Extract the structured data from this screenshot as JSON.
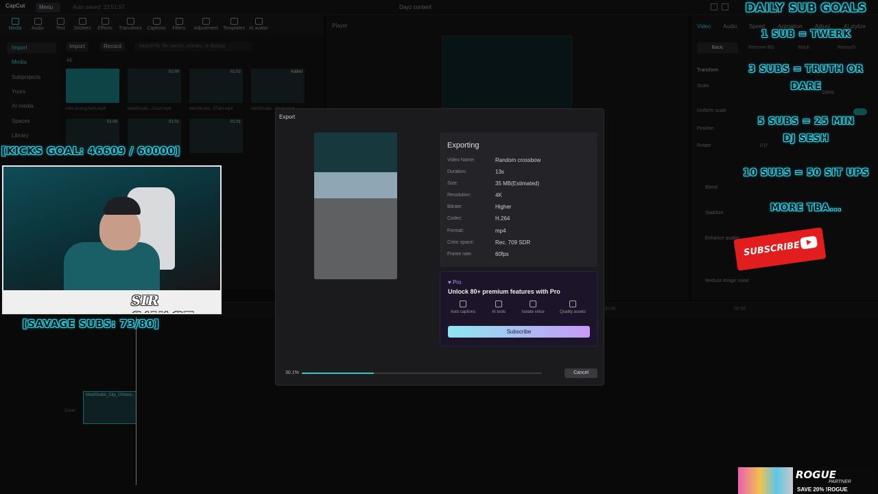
{
  "app": {
    "logo": "CapCut",
    "menu_label": "Menu",
    "autosave": "Auto saved: 23:51:57",
    "project_title": "Dayz content"
  },
  "toolbar": {
    "items": [
      "Media",
      "Audio",
      "Text",
      "Stickers",
      "Effects",
      "Transitions",
      "Captions",
      "Filters",
      "Adjustment",
      "Templates",
      "AI avatar"
    ]
  },
  "left_nav": {
    "items": [
      "Import",
      "Media",
      "Subprojects",
      "Yours",
      "AI media",
      "Spaces",
      "Library"
    ]
  },
  "media": {
    "import_label": "Import",
    "record_label": "Record",
    "search_placeholder": "Search for file names, scenes, or dialogs",
    "filter_all": "All",
    "thumbs": [
      {
        "dur": "",
        "name": "intro to king farm.mp4"
      },
      {
        "dur": "01:00",
        "name": "MeldStudio...21am.mp4"
      },
      {
        "dur": "01:02",
        "name": "MeldStudio...07am.mp4"
      },
      {
        "dur": "Added",
        "name": "MeldStudio...44am.mp4"
      },
      {
        "dur": "01:00",
        "name": ""
      },
      {
        "dur": "01:01",
        "name": ""
      },
      {
        "dur": "01:01",
        "name": ""
      }
    ]
  },
  "player": {
    "title": "Player"
  },
  "inspector": {
    "tabs": [
      "Video",
      "Audio",
      "Speed",
      "Animation",
      "Adjust",
      "AI stylize"
    ],
    "subtabs": [
      "Basic",
      "Remove BG",
      "Mask",
      "Retouch"
    ],
    "props": [
      "Transform",
      "Scale",
      "Uniform scale",
      "Position",
      "Rotate",
      "Blend",
      "Stabilize",
      "Enhance quality",
      "Reduce image noise"
    ],
    "scale_value": "100%",
    "rotate_value": "0.0°"
  },
  "export": {
    "title": "Export",
    "heading": "Exporting",
    "fields": [
      {
        "key": "Video Name:",
        "value": "Random crossbow"
      },
      {
        "key": "Duration:",
        "value": "13s"
      },
      {
        "key": "Size:",
        "value": "35 MB(Estimated)"
      },
      {
        "key": "Resolution:",
        "value": "4K"
      },
      {
        "key": "Bitrate:",
        "value": "Higher"
      },
      {
        "key": "Codec:",
        "value": "H.264"
      },
      {
        "key": "Format:",
        "value": "mp4"
      },
      {
        "key": "Color space:",
        "value": "Rec. 709 SDR"
      },
      {
        "key": "Frame rate:",
        "value": "60fps"
      }
    ],
    "pro_badge": "♥ Pro",
    "pro_unlock": "Unlock 80+ premium features with Pro",
    "pro_features": [
      "Auto captions",
      "AI tools",
      "Isolate voice",
      "Quality assets"
    ],
    "subscribe_label": "Subscribe",
    "progress_label": "30.1%",
    "progress": 0.301,
    "cancel_label": "Cancel"
  },
  "timeline": {
    "clip_label": "MeldStudio_Clip_Chrono...",
    "cover_label": "Cover",
    "time_marks": [
      "00:05",
      "00:50"
    ]
  },
  "overlay": {
    "kicks_goal": "[KICKS GOAL:  46609 / 60000]",
    "savage_subs": "[SAVAGE SUBS: 73/80]",
    "daily_goals_title": "DAILY SUB GOALS",
    "goals": [
      "1 SUB = TWERK",
      "3 SUBS = TRUTH OR",
      "DARE",
      "5 SUBS = 25 MIN",
      "DJ SESH",
      "10 SUBS = 50 SIT UPS",
      "MORE TBA..."
    ],
    "webcam_signature": "SIR SAVAGE",
    "subscribe_graphic": "SUBSCRIBE",
    "rogue_brand": "ROGUE",
    "rogue_partner": "PARTNER",
    "rogue_save": "SAVE 20% !ROGUE"
  },
  "colors": {
    "accent": "#35c8cc",
    "glow": "#22d6e8",
    "pro": "#b794ff",
    "subscribe_red": "#e11d1d"
  }
}
